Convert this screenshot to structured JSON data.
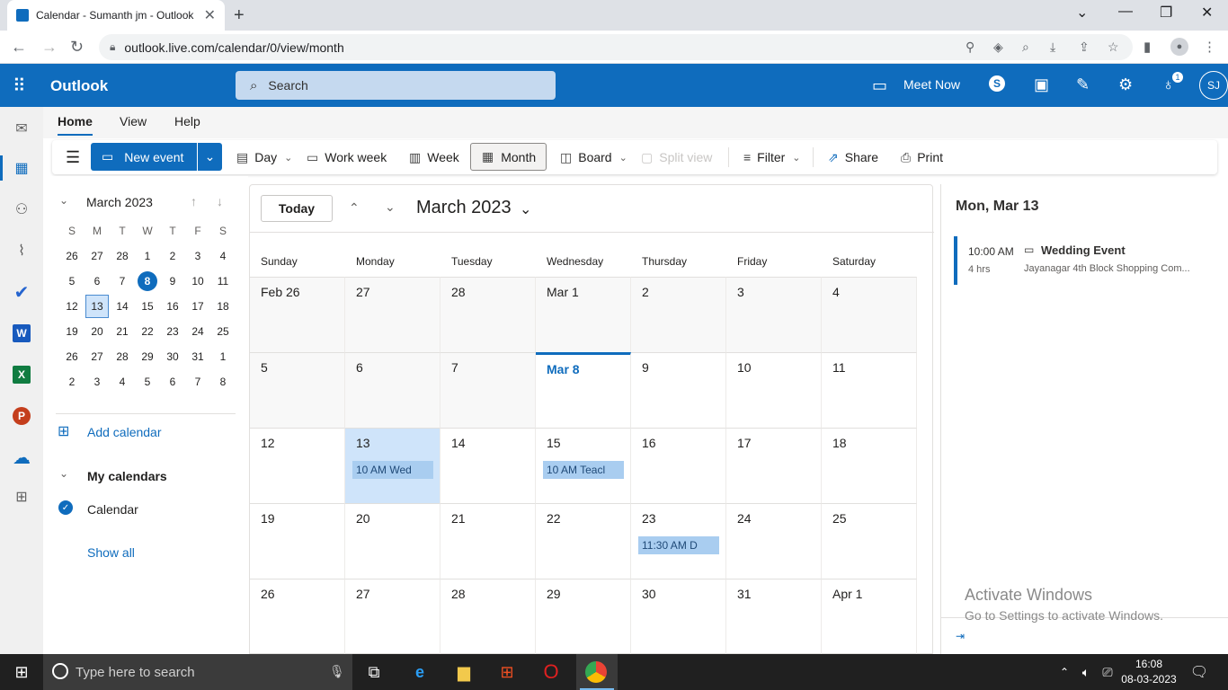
{
  "browser": {
    "tab_title": "Calendar - Sumanth jm - Outlook",
    "url": "outlook.live.com/calendar/0/view/month"
  },
  "header": {
    "app_name": "Outlook",
    "search_placeholder": "Search",
    "meet_now": "Meet Now",
    "notification_count": "1",
    "avatar_initials": "SJ"
  },
  "ribbon_tabs": [
    "Home",
    "View",
    "Help"
  ],
  "ribbon": {
    "new_event": "New event",
    "day": "Day",
    "work_week": "Work week",
    "week": "Week",
    "month": "Month",
    "board": "Board",
    "split_view": "Split view",
    "filter": "Filter",
    "share": "Share",
    "print": "Print"
  },
  "mini_calendar": {
    "title": "March 2023",
    "weekday_headers": [
      "S",
      "M",
      "T",
      "W",
      "T",
      "F",
      "S"
    ],
    "weeks": [
      [
        "26",
        "27",
        "28",
        "1",
        "2",
        "3",
        "4"
      ],
      [
        "5",
        "6",
        "7",
        "8",
        "9",
        "10",
        "11"
      ],
      [
        "12",
        "13",
        "14",
        "15",
        "16",
        "17",
        "18"
      ],
      [
        "19",
        "20",
        "21",
        "22",
        "23",
        "24",
        "25"
      ],
      [
        "26",
        "27",
        "28",
        "29",
        "30",
        "31",
        "1"
      ],
      [
        "2",
        "3",
        "4",
        "5",
        "6",
        "7",
        "8"
      ]
    ]
  },
  "side": {
    "add_calendar": "Add calendar",
    "my_calendars": "My calendars",
    "calendar": "Calendar",
    "show_all": "Show all"
  },
  "main": {
    "today_button": "Today",
    "month_title": "March 2023",
    "weekdays": [
      "Sunday",
      "Monday",
      "Tuesday",
      "Wednesday",
      "Thursday",
      "Friday",
      "Saturday"
    ],
    "weeks": [
      [
        "Feb 26",
        "27",
        "28",
        "Mar 1",
        "2",
        "3",
        "4"
      ],
      [
        "5",
        "6",
        "7",
        "Mar 8",
        "9",
        "10",
        "11"
      ],
      [
        "12",
        "13",
        "14",
        "15",
        "16",
        "17",
        "18"
      ],
      [
        "19",
        "20",
        "21",
        "22",
        "23",
        "24",
        "25"
      ],
      [
        "26",
        "27",
        "28",
        "29",
        "30",
        "31",
        "Apr 1"
      ]
    ],
    "events": {
      "mon13": "10 AM  Wed",
      "wed15": "10 AM  Teacl",
      "thu23": "11:30 AM  D"
    }
  },
  "agenda": {
    "date_heading": "Mon, Mar 13",
    "event_time": "10:00 AM",
    "event_duration": "4 hrs",
    "event_title": "Wedding Event",
    "event_location": "Jayanagar 4th Block Shopping Com..."
  },
  "watermark": {
    "line1": "Activate Windows",
    "line2": "Go to Settings to activate Windows."
  },
  "taskbar": {
    "search_placeholder": "Type here to search",
    "time": "16:08",
    "date": "08-03-2023"
  }
}
